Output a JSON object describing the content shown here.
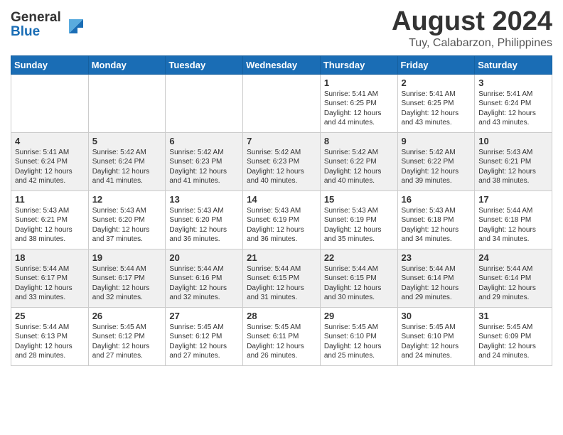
{
  "header": {
    "logo_line1": "General",
    "logo_line2": "Blue",
    "month_title": "August 2024",
    "location": "Tuy, Calabarzon, Philippines"
  },
  "weekdays": [
    "Sunday",
    "Monday",
    "Tuesday",
    "Wednesday",
    "Thursday",
    "Friday",
    "Saturday"
  ],
  "weeks": [
    [
      {
        "day": "",
        "info": ""
      },
      {
        "day": "",
        "info": ""
      },
      {
        "day": "",
        "info": ""
      },
      {
        "day": "",
        "info": ""
      },
      {
        "day": "1",
        "info": "Sunrise: 5:41 AM\nSunset: 6:25 PM\nDaylight: 12 hours\nand 44 minutes."
      },
      {
        "day": "2",
        "info": "Sunrise: 5:41 AM\nSunset: 6:25 PM\nDaylight: 12 hours\nand 43 minutes."
      },
      {
        "day": "3",
        "info": "Sunrise: 5:41 AM\nSunset: 6:24 PM\nDaylight: 12 hours\nand 43 minutes."
      }
    ],
    [
      {
        "day": "4",
        "info": "Sunrise: 5:41 AM\nSunset: 6:24 PM\nDaylight: 12 hours\nand 42 minutes."
      },
      {
        "day": "5",
        "info": "Sunrise: 5:42 AM\nSunset: 6:24 PM\nDaylight: 12 hours\nand 41 minutes."
      },
      {
        "day": "6",
        "info": "Sunrise: 5:42 AM\nSunset: 6:23 PM\nDaylight: 12 hours\nand 41 minutes."
      },
      {
        "day": "7",
        "info": "Sunrise: 5:42 AM\nSunset: 6:23 PM\nDaylight: 12 hours\nand 40 minutes."
      },
      {
        "day": "8",
        "info": "Sunrise: 5:42 AM\nSunset: 6:22 PM\nDaylight: 12 hours\nand 40 minutes."
      },
      {
        "day": "9",
        "info": "Sunrise: 5:42 AM\nSunset: 6:22 PM\nDaylight: 12 hours\nand 39 minutes."
      },
      {
        "day": "10",
        "info": "Sunrise: 5:43 AM\nSunset: 6:21 PM\nDaylight: 12 hours\nand 38 minutes."
      }
    ],
    [
      {
        "day": "11",
        "info": "Sunrise: 5:43 AM\nSunset: 6:21 PM\nDaylight: 12 hours\nand 38 minutes."
      },
      {
        "day": "12",
        "info": "Sunrise: 5:43 AM\nSunset: 6:20 PM\nDaylight: 12 hours\nand 37 minutes."
      },
      {
        "day": "13",
        "info": "Sunrise: 5:43 AM\nSunset: 6:20 PM\nDaylight: 12 hours\nand 36 minutes."
      },
      {
        "day": "14",
        "info": "Sunrise: 5:43 AM\nSunset: 6:19 PM\nDaylight: 12 hours\nand 36 minutes."
      },
      {
        "day": "15",
        "info": "Sunrise: 5:43 AM\nSunset: 6:19 PM\nDaylight: 12 hours\nand 35 minutes."
      },
      {
        "day": "16",
        "info": "Sunrise: 5:43 AM\nSunset: 6:18 PM\nDaylight: 12 hours\nand 34 minutes."
      },
      {
        "day": "17",
        "info": "Sunrise: 5:44 AM\nSunset: 6:18 PM\nDaylight: 12 hours\nand 34 minutes."
      }
    ],
    [
      {
        "day": "18",
        "info": "Sunrise: 5:44 AM\nSunset: 6:17 PM\nDaylight: 12 hours\nand 33 minutes."
      },
      {
        "day": "19",
        "info": "Sunrise: 5:44 AM\nSunset: 6:17 PM\nDaylight: 12 hours\nand 32 minutes."
      },
      {
        "day": "20",
        "info": "Sunrise: 5:44 AM\nSunset: 6:16 PM\nDaylight: 12 hours\nand 32 minutes."
      },
      {
        "day": "21",
        "info": "Sunrise: 5:44 AM\nSunset: 6:15 PM\nDaylight: 12 hours\nand 31 minutes."
      },
      {
        "day": "22",
        "info": "Sunrise: 5:44 AM\nSunset: 6:15 PM\nDaylight: 12 hours\nand 30 minutes."
      },
      {
        "day": "23",
        "info": "Sunrise: 5:44 AM\nSunset: 6:14 PM\nDaylight: 12 hours\nand 29 minutes."
      },
      {
        "day": "24",
        "info": "Sunrise: 5:44 AM\nSunset: 6:14 PM\nDaylight: 12 hours\nand 29 minutes."
      }
    ],
    [
      {
        "day": "25",
        "info": "Sunrise: 5:44 AM\nSunset: 6:13 PM\nDaylight: 12 hours\nand 28 minutes."
      },
      {
        "day": "26",
        "info": "Sunrise: 5:45 AM\nSunset: 6:12 PM\nDaylight: 12 hours\nand 27 minutes."
      },
      {
        "day": "27",
        "info": "Sunrise: 5:45 AM\nSunset: 6:12 PM\nDaylight: 12 hours\nand 27 minutes."
      },
      {
        "day": "28",
        "info": "Sunrise: 5:45 AM\nSunset: 6:11 PM\nDaylight: 12 hours\nand 26 minutes."
      },
      {
        "day": "29",
        "info": "Sunrise: 5:45 AM\nSunset: 6:10 PM\nDaylight: 12 hours\nand 25 minutes."
      },
      {
        "day": "30",
        "info": "Sunrise: 5:45 AM\nSunset: 6:10 PM\nDaylight: 12 hours\nand 24 minutes."
      },
      {
        "day": "31",
        "info": "Sunrise: 5:45 AM\nSunset: 6:09 PM\nDaylight: 12 hours\nand 24 minutes."
      }
    ]
  ]
}
